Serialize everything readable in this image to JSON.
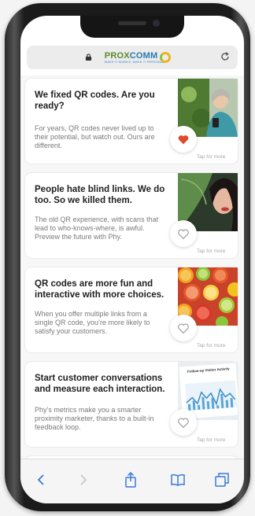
{
  "browser": {
    "brand_main": "PROX",
    "brand_accent": "COMM",
    "brand_tagline": "MAKE IT MOBILE, MAKE IT PERSONAL",
    "lock_icon": "lock-icon",
    "reload_icon": "reload-icon"
  },
  "cards": [
    {
      "title": "We fixed QR codes. Are you ready?",
      "body": "For years, QR codes never lived up to their potential, but watch out. Ours are different.",
      "tap": "Tap for more",
      "liked": true
    },
    {
      "title": "People hate blind links. We do too. So we killed them.",
      "body": "The old QR experience, with scans that lead to who-knows-where, is awful. Preview the future with Phy.",
      "tap": "Tap for more",
      "liked": false
    },
    {
      "title": "QR codes are more fun and interactive with more choices.",
      "body": "When you offer multiple links from a single QR code, you’re more likely to satisfy your customers.",
      "tap": "Tap for more",
      "liked": false
    },
    {
      "title": "Start customer conversations and measure each interaction.",
      "body": "Phy’s metrics make you a smarter proximity marketer, thanks to a built-in feedback loop.",
      "tap": "Tap for more",
      "liked": false,
      "chart_caption": "Follow-up Visitor Activity"
    }
  ],
  "toolbar": {
    "back_icon": "chevron-left-icon",
    "forward_icon": "chevron-right-icon",
    "share_icon": "share-icon",
    "bookmarks_icon": "book-icon",
    "tabs_icon": "tabs-icon"
  },
  "colors": {
    "heart_filled": "#e0492a",
    "heart_outline": "#9a9a9a",
    "brand_green": "#5a8a2a",
    "brand_blue": "#2a7ab0"
  }
}
